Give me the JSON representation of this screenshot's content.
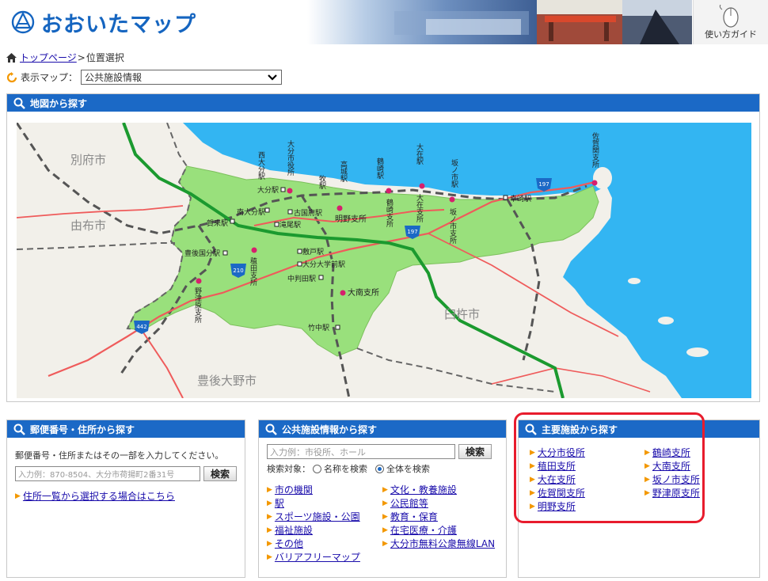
{
  "header": {
    "logo_text": "おおいたマップ",
    "guide_label": "使い方ガイド"
  },
  "breadcrumb": {
    "home_label": "トップページ",
    "separator": ">",
    "current": "位置選択"
  },
  "map_select": {
    "label": "表示マップ：",
    "value": "公共施設情報"
  },
  "map_section": {
    "title": "地図から探す",
    "labels": {
      "beppu": "別府市",
      "yufu": "由布市",
      "usuki": "臼杵市",
      "bungoono": "豊後大野市",
      "oita_sta": "大分駅",
      "nishioita": "西大分駅",
      "minamioita": "南大分駅",
      "kozaki": "古国府駅",
      "takio": "滝尾駅",
      "kenjiri": "賀来駅",
      "bungokokubu": "豊後国分駅",
      "shikido": "敷戸駅",
      "oitadaigakumae": "大分大学前駅",
      "nakahanda": "中判田駅",
      "takenaka": "竹中駅",
      "kozaki_e": "幸崎駅",
      "akeno": "明野支所",
      "onan": "大南支所",
      "route210": "210",
      "route197a": "197",
      "route197b": "197",
      "route442": "442"
    },
    "vertical_labels": {
      "nishioita_v": "西大分駅",
      "shiyakusho_v": "大分市役所",
      "takashiro_v": "高城駅",
      "tsurusaki_v": "鶴崎駅",
      "ozai_v": "大在駅",
      "sakanoichi_v": "坂ノ市駅",
      "saganoseki_v": "佐賀関支所",
      "makidori_v": "牧駅",
      "tsurusaki_shisho_v": "鶴崎支所",
      "ozai_shisho_v": "大在支所",
      "sakanoichi_shisho_v": "坂ノ市支所",
      "inada_v": "稙田支所",
      "notsuharu_v": "野津原支所"
    }
  },
  "postal_panel": {
    "title": "郵便番号・住所から探す",
    "instructions": "郵便番号・住所またはその一部を入力してください。",
    "placeholder": "入力例：870-8504、大分市荷揚町2番31号",
    "search_label": "検索",
    "list_link": "住所一覧から選択する場合はこちら"
  },
  "public_panel": {
    "title": "公共施設情報から探す",
    "placeholder": "入力例：市役所、ホール",
    "search_label": "検索",
    "target_label": "検索対象：",
    "radio_name": "名称を検索",
    "radio_all": "全体を検索",
    "left_links": [
      "市の機関",
      "駅",
      "スポーツ施設・公園",
      "福祉施設",
      "その他",
      "バリアフリーマップ"
    ],
    "right_links": [
      "文化・教養施設",
      "公民館等",
      "教育・保育",
      "在宅医療・介護",
      "大分市無料公衆無線LAN"
    ]
  },
  "major_panel": {
    "title": "主要施設から探す",
    "left_links": [
      "大分市役所",
      "稙田支所",
      "大在支所",
      "佐賀関支所",
      "明野支所"
    ],
    "right_links": [
      "鶴崎支所",
      "大南支所",
      "坂ノ市支所",
      "野津原支所"
    ]
  },
  "colors": {
    "accent": "#1b69c6",
    "link": "#1a0dab",
    "highlight": "#e81c2d",
    "sea": "#33b5f2",
    "city_area": "#99e07c"
  }
}
